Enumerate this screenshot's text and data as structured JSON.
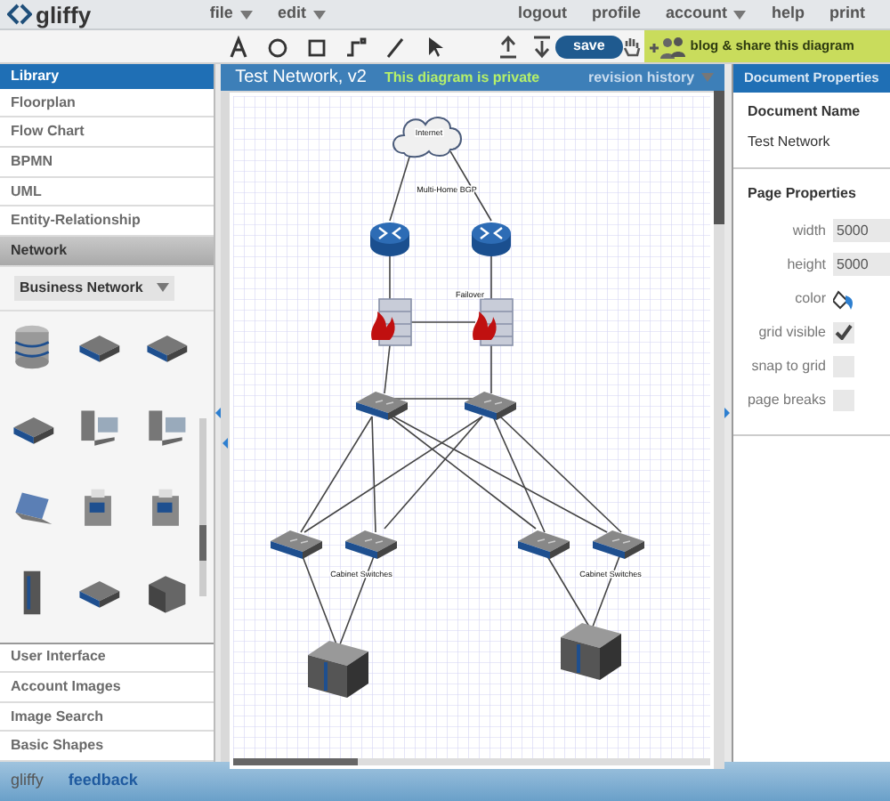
{
  "logo": "gliffy",
  "top_menu": [
    {
      "label": "file",
      "has_menu": true
    },
    {
      "label": "edit",
      "has_menu": true
    },
    {
      "label": "logout",
      "has_menu": false
    },
    {
      "label": "profile",
      "has_menu": false
    },
    {
      "label": "account",
      "has_menu": true
    },
    {
      "label": "help",
      "has_menu": false
    },
    {
      "label": "print",
      "has_menu": false
    }
  ],
  "toolbar": {
    "save": "save",
    "share": "blog & share this diagram"
  },
  "library": {
    "title": "Library",
    "categories": [
      {
        "label": "Floorplan",
        "selected": false
      },
      {
        "label": "Flow Chart",
        "selected": false
      },
      {
        "label": "BPMN",
        "selected": false
      },
      {
        "label": "UML",
        "selected": false
      },
      {
        "label": "Entity-Relationship",
        "selected": false
      },
      {
        "label": "Network",
        "selected": true
      },
      {
        "label": "User Interface",
        "selected": false
      },
      {
        "label": "Account Images",
        "selected": false
      },
      {
        "label": "Image Search",
        "selected": false
      },
      {
        "label": "Basic Shapes",
        "selected": false
      }
    ],
    "palette_select": "Business Network"
  },
  "canvas": {
    "title": "Test Network, v2",
    "privacy": "This diagram is private",
    "revision_history": "revision history",
    "labels": [
      {
        "kind": "cloud",
        "text": "Internet"
      },
      {
        "kind": "bgp",
        "text": "Multi-Home BGP"
      },
      {
        "kind": "failover",
        "text": "Failover"
      },
      {
        "kind": "cabinet_left",
        "text": "Cabinet Switches"
      },
      {
        "kind": "cabinet_right",
        "text": "Cabinet Switches"
      }
    ]
  },
  "properties": {
    "title": "Document Properties",
    "name_label": "Document Name",
    "name_value": "Test Network",
    "page_title": "Page Properties",
    "fields": [
      {
        "kind": "text",
        "label": "width",
        "value": "5000"
      },
      {
        "kind": "text",
        "label": "height",
        "value": "5000"
      },
      {
        "kind": "color",
        "label": "color"
      },
      {
        "kind": "checkbox",
        "label": "grid visible",
        "checked": true
      },
      {
        "kind": "checkbox",
        "label": "snap to grid",
        "checked": false
      },
      {
        "kind": "checkbox",
        "label": "page breaks",
        "checked": false
      }
    ]
  },
  "footer": {
    "brand": "gliffy",
    "link": "feedback"
  }
}
